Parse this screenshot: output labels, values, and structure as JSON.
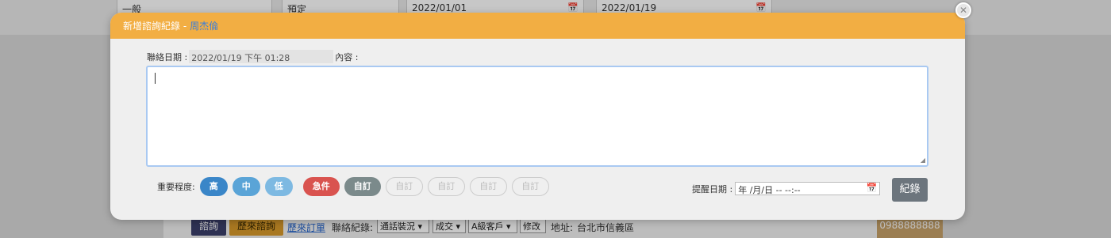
{
  "background": {
    "top_fields": [
      {
        "value": "一般"
      },
      {
        "value": "預定"
      },
      {
        "value": "2022/01/01"
      },
      {
        "value": "2022/01/19"
      }
    ],
    "bottom_bar": {
      "inquiry_button": "諮詢",
      "history_inquiry_button": "歷來諮詢",
      "history_orders_link": "歷來訂單",
      "contact_record_label": "聯絡紀錄:",
      "contact_status_select": "通話裝況",
      "deal_select": "成交",
      "customer_level_select": "A級客戶",
      "edit_button": "修改",
      "address_label": "地址:",
      "address_value": "台北市信義區",
      "phone": "0988888888"
    }
  },
  "modal": {
    "title": "新增諮詢紀錄 -",
    "customer_name": "周杰倫",
    "contact_date_label": "聯絡日期 :",
    "contact_date_value": "2022/01/19 下午 01:28",
    "content_label": "內容 :",
    "content_value": "",
    "importance_label": "重要程度:",
    "importance_buttons": [
      "高",
      "中",
      "低"
    ],
    "urgent_button": "急件",
    "custom_buttons": [
      "自訂",
      "自訂",
      "自訂",
      "自訂",
      "自訂"
    ],
    "reminder_label": "提醒日期 :",
    "reminder_placeholder": "年 /月/日 -- --:--",
    "save_button": "紀錄"
  },
  "colors": {
    "header": "#f2ae43",
    "customer_name": "#3d7fd9",
    "importance_high": "#3a86c8",
    "urgent": "#d9534f",
    "custom_active": "#7b8a8b",
    "save": "#6c757d"
  },
  "icons": {
    "close": "close-icon",
    "calendar": "calendar-icon",
    "resize": "resize-grip-icon"
  }
}
